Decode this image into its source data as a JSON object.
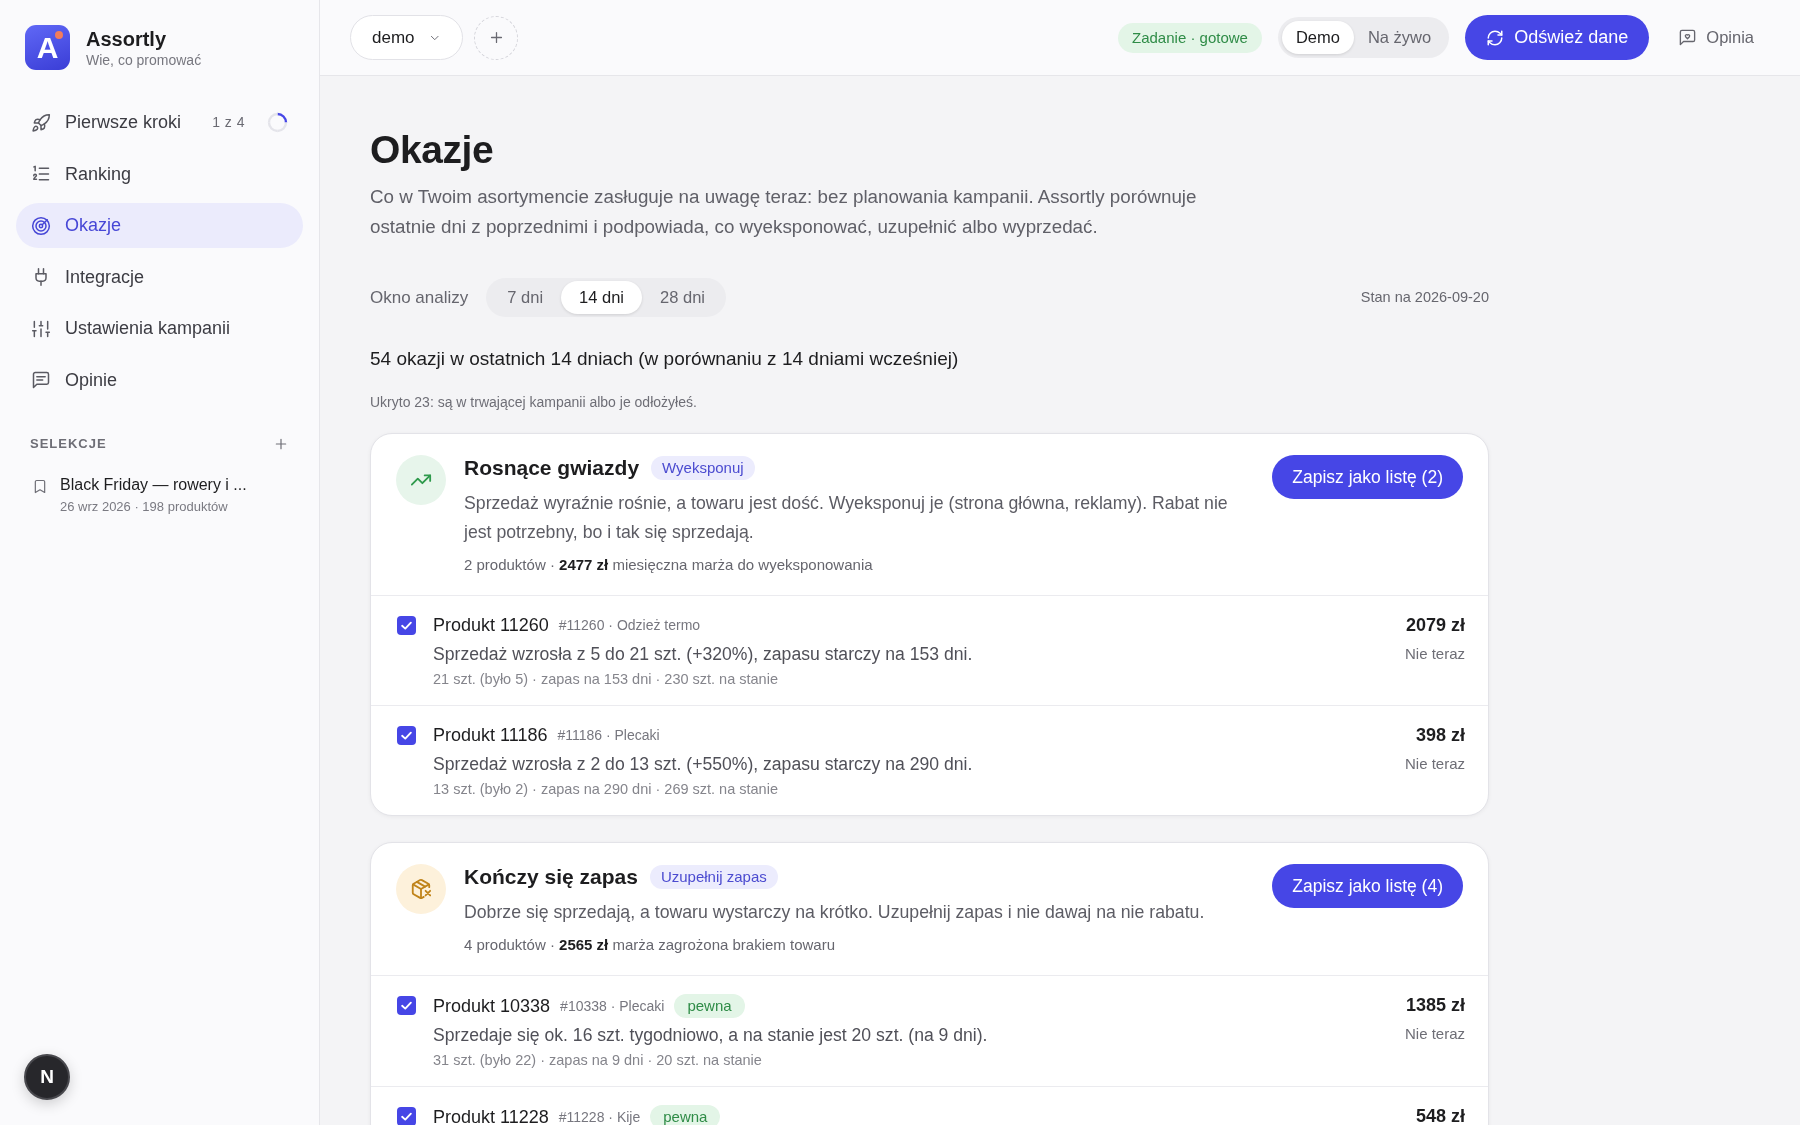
{
  "sidebar": {
    "logo": {
      "mark": "A",
      "name": "Assortly",
      "tagline": "Wie, co promować"
    },
    "nav": [
      {
        "label": "Pierwsze kroki",
        "selected": false,
        "progress": {
          "text": "1 z 4",
          "steps": [
            {
              "done": true
            },
            {
              "done": false
            },
            {
              "done": false
            },
            {
              "done": false
            }
          ]
        }
      },
      {
        "label": "Ranking",
        "selected": false
      },
      {
        "label": "Okazje",
        "selected": true
      },
      {
        "label": "Integracje",
        "selected": false
      },
      {
        "label": "Ustawienia kampanii",
        "selected": false
      },
      {
        "label": "Opinie",
        "selected": false
      }
    ],
    "selections": {
      "heading": "SELEKCJE",
      "items": [
        {
          "title": "Black Friday — rowery i ...",
          "meta": "26 wrz 2026 · 198 produktów"
        }
      ]
    },
    "corner_button": "N"
  },
  "topbar": {
    "workspace": "demo",
    "status": "Zadanie · gotowe",
    "modes": [
      {
        "label": "Demo",
        "selected": true
      },
      {
        "label": "Na żywo",
        "selected": false
      }
    ],
    "refresh": "Odśwież dane",
    "feedback": "Opinia"
  },
  "page": {
    "title": "Okazje",
    "description": "Co w Twoim asortymencie zasługuje na uwagę teraz: bez planowania kampanii. Assortly porównuje ostatnie dni z poprzednimi i podpowiada, co wyeksponować, uzupełnić albo wyprzedać.",
    "window": {
      "label": "Okno analizy",
      "options": [
        {
          "label": "7 dni",
          "selected": false
        },
        {
          "label": "14 dni",
          "selected": true
        },
        {
          "label": "28 dni",
          "selected": false
        }
      ]
    },
    "as_of": "Stan na 2026-09-20",
    "summary": "54 okazji w ostatnich 14 dniach (w porównaniu z 14 dniami wcześniej)",
    "hidden_note": "Ukryto 23: są w trwającej kampanii albo je odłożyłeś."
  },
  "groups": [
    {
      "kind": "rising",
      "title": "Rosnące gwiazdy",
      "badge": "Wyeksponuj",
      "description": "Sprzedaż wyraźnie rośnie, a towaru jest dość. Wyeksponuj je (strona główna, reklamy). Rabat nie jest potrzebny, bo i tak się sprzedają.",
      "meta": "2 produktów · **2477 zł** miesięczna marża do wyeksponowania",
      "button": "Zapisz jako listę (2)",
      "products": [
        {
          "name": "Produkt 11260",
          "meta": "#11260 · Odzież termo",
          "checked": true,
          "summary": "Sprzedaż wzrosła z 5 do 21 szt. (+320%), zapasu starczy na 153 dni.",
          "details": "21 szt. (było 5) · zapas na 153 dni · 230 szt. na stanie",
          "price": "2079 zł",
          "action": "Nie teraz"
        },
        {
          "name": "Produkt 11186",
          "meta": "#11186 · Plecaki",
          "checked": true,
          "summary": "Sprzedaż wzrosła z 2 do 13 szt. (+550%), zapasu starczy na 290 dni.",
          "details": "13 szt. (było 2) · zapas na 290 dni · 269 szt. na stanie",
          "price": "398 zł",
          "action": "Nie teraz"
        }
      ]
    },
    {
      "kind": "low_stock",
      "title": "Kończy się zapas",
      "badge": "Uzupełnij zapas",
      "description": "Dobrze się sprzedają, a towaru wystarczy na krótko. Uzupełnij zapas i nie dawaj na nie rabatu.",
      "meta": "4 produktów · **2565 zł** marża zagrożona brakiem towaru",
      "button": "Zapisz jako listę (4)",
      "products": [
        {
          "name": "Produkt 10338",
          "meta": "#10338 · Plecaki",
          "tag": "pewna",
          "checked": true,
          "summary": "Sprzedaje się ok. 16 szt. tygodniowo, a na stanie jest 20 szt. (na 9 dni).",
          "details": "31 szt. (było 22) · zapas na 9 dni · 20 szt. na stanie",
          "price": "1385 zł",
          "action": "Nie teraz"
        },
        {
          "name": "Produkt 11228",
          "meta": "#11228 · Kije",
          "tag": "pewna",
          "checked": true,
          "price": "548 zł"
        }
      ]
    }
  ]
}
